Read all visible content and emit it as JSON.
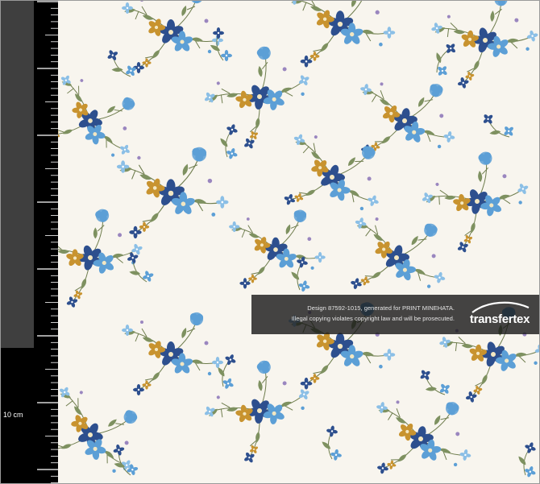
{
  "ruler": {
    "label": "10 cm",
    "colors": {
      "upper": "#3f3f3f",
      "lower": "#000000",
      "ticks": "#ffffff"
    }
  },
  "fabric": {
    "background": "#f8f5ee",
    "motif_colors": {
      "navy": "#2d4f8e",
      "sky": "#5c9fd6",
      "light_blue": "#8bbfe6",
      "ochre": "#c8932f",
      "stem": "#6f7d4e",
      "leaf": "#7e9160",
      "lavender": "#9a86bf"
    }
  },
  "watermark": {
    "line1": "Design 87592-1015, generated for PRINT MINEHATA.",
    "line2": "Illegal copying violates copyright law and will be prosecuted.",
    "brand": "transfertex"
  }
}
